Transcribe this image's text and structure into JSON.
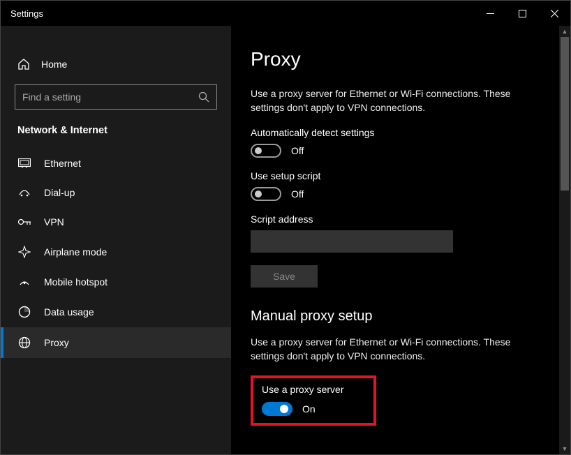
{
  "titlebar": {
    "title": "Settings"
  },
  "sidebar": {
    "home_label": "Home",
    "search_placeholder": "Find a setting",
    "section_label": "Network & Internet",
    "items": [
      {
        "label": "Ethernet"
      },
      {
        "label": "Dial-up"
      },
      {
        "label": "VPN"
      },
      {
        "label": "Airplane mode"
      },
      {
        "label": "Mobile hotspot"
      },
      {
        "label": "Data usage"
      },
      {
        "label": "Proxy"
      }
    ]
  },
  "main": {
    "page_title": "Proxy",
    "intro_text": "Use a proxy server for Ethernet or Wi-Fi connections. These settings don't apply to VPN connections.",
    "auto_detect_label": "Automatically detect settings",
    "auto_detect_state": "Off",
    "use_script_label": "Use setup script",
    "use_script_state": "Off",
    "script_address_label": "Script address",
    "script_address_value": "",
    "save_label": "Save",
    "manual_heading": "Manual proxy setup",
    "manual_text": "Use a proxy server for Ethernet or Wi-Fi connections. These settings don't apply to VPN connections.",
    "use_proxy_label": "Use a proxy server",
    "use_proxy_state": "On"
  }
}
